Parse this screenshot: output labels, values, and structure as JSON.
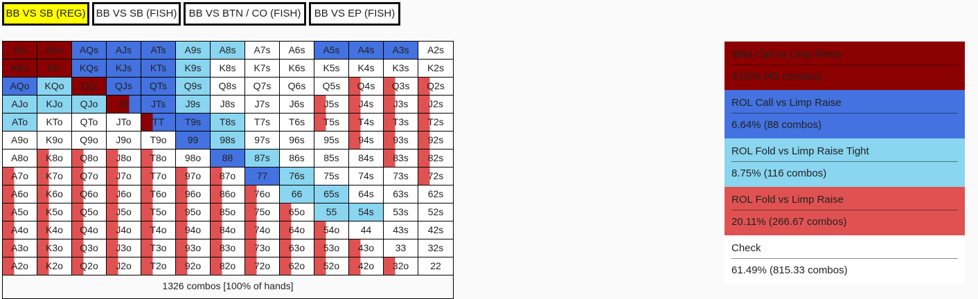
{
  "tabs": [
    {
      "label": "BB VS SB (REG)",
      "active": true
    },
    {
      "label": "BB VS SB (FISH)"
    },
    {
      "label": "BB VS BTN / CO (FISH)"
    },
    {
      "label": "BB VS EP (FISH)"
    }
  ],
  "colors": {
    "tab_active": "#ffff00",
    "check": "#ffffff"
  },
  "actions": [
    {
      "name": "4Bet Call vs Limp Raise",
      "stat": "3.02%  (40 combos)",
      "color": "#8b0000"
    },
    {
      "name": "ROL Call vs Limp Raise",
      "stat": "6.64%  (88 combos)",
      "color": "#4472e0"
    },
    {
      "name": "ROL Fold vs Limp Raise Tight",
      "stat": "8.75%  (116 combos)",
      "color": "#8ad5f0"
    },
    {
      "name": "ROL Fold vs Limp Raise",
      "stat": "20.11%  (266.67 combos)",
      "color": "#e05252"
    },
    {
      "name": "Check",
      "stat": "61.49%  (815.33 combos)",
      "color": "#ffffff"
    }
  ],
  "grid": [
    [
      "AA",
      "AKs",
      "AQs",
      "AJs",
      "ATs",
      "A9s",
      "A8s",
      "A7s",
      "A6s",
      "A5s",
      "A4s",
      "A3s",
      "A2s"
    ],
    [
      "AKo",
      "KK",
      "KQs",
      "KJs",
      "KTs",
      "K9s",
      "K8s",
      "K7s",
      "K6s",
      "K5s",
      "K4s",
      "K3s",
      "K2s"
    ],
    [
      "AQo",
      "KQo",
      "QQ",
      "QJs",
      "QTs",
      "Q9s",
      "Q8s",
      "Q7s",
      "Q6s",
      "Q5s",
      "Q4s",
      "Q3s",
      "Q2s"
    ],
    [
      "AJo",
      "KJo",
      "QJo",
      "JJ",
      "JTs",
      "J9s",
      "J8s",
      "J7s",
      "J6s",
      "J5s",
      "J4s",
      "J3s",
      "J2s"
    ],
    [
      "ATo",
      "KTo",
      "QTo",
      "JTo",
      "TT",
      "T9s",
      "T8s",
      "T7s",
      "T6s",
      "T5s",
      "T4s",
      "T3s",
      "T2s"
    ],
    [
      "A9o",
      "K9o",
      "Q9o",
      "J9o",
      "T9o",
      "99",
      "98s",
      "97s",
      "96s",
      "95s",
      "94s",
      "93s",
      "92s"
    ],
    [
      "A8o",
      "K8o",
      "Q8o",
      "J8o",
      "T8o",
      "98o",
      "88",
      "87s",
      "86s",
      "85s",
      "84s",
      "83s",
      "82s"
    ],
    [
      "A7o",
      "K7o",
      "Q7o",
      "J7o",
      "T7o",
      "97o",
      "87o",
      "77",
      "76s",
      "75s",
      "74s",
      "73s",
      "72s"
    ],
    [
      "A6o",
      "K6o",
      "Q6o",
      "J6o",
      "T6o",
      "96o",
      "86o",
      "76o",
      "66",
      "65s",
      "64s",
      "63s",
      "62s"
    ],
    [
      "A5o",
      "K5o",
      "Q5o",
      "J5o",
      "T5o",
      "95o",
      "85o",
      "75o",
      "65o",
      "55",
      "54s",
      "53s",
      "52s"
    ],
    [
      "A4o",
      "K4o",
      "Q4o",
      "J4o",
      "T4o",
      "94o",
      "84o",
      "74o",
      "64o",
      "54o",
      "44",
      "43s",
      "42s"
    ],
    [
      "A3o",
      "K3o",
      "Q3o",
      "J3o",
      "T3o",
      "93o",
      "83o",
      "73o",
      "63o",
      "53o",
      "43o",
      "33",
      "32s"
    ],
    [
      "A2o",
      "K2o",
      "Q2o",
      "J2o",
      "T2o",
      "92o",
      "82o",
      "72o",
      "62o",
      "52o",
      "42o",
      "32o",
      "22"
    ]
  ],
  "range": {
    "full": {
      "0": [
        "AA",
        "AKs",
        "AKo",
        "KK",
        "QQ"
      ],
      "1": [
        "AQs",
        "AJs",
        "ATs",
        "A5s",
        "A4s",
        "A3s",
        "KQs",
        "KJs",
        "KTs",
        "QJs",
        "QTs",
        "JTs",
        "T9s",
        "99",
        "88",
        "77",
        "AQo"
      ],
      "2": [
        "A9s",
        "A8s",
        "K9s",
        "Q9s",
        "J9s",
        "T8s",
        "98s",
        "87s",
        "76s",
        "65s",
        "54s",
        "66",
        "55",
        "KQo",
        "AJo",
        "KJo",
        "QJo",
        "ATo"
      ]
    },
    "mixed": {
      "JJ": [
        [
          0,
          0.667
        ],
        [
          1,
          0.333
        ]
      ],
      "TT": [
        [
          0,
          0.333
        ],
        [
          1,
          0.667
        ]
      ]
    },
    "third_of_action_3": [
      "K8o",
      "Q8o",
      "J8o",
      "T8o",
      "A7o",
      "K7o",
      "Q7o",
      "J7o",
      "T7o",
      "97o",
      "87o",
      "A6o",
      "K6o",
      "Q6o",
      "J6o",
      "T6o",
      "96o",
      "86o",
      "76o",
      "A5o",
      "K5o",
      "Q5o",
      "J5o",
      "T5o",
      "95o",
      "85o",
      "75o",
      "65o",
      "A4o",
      "K4o",
      "Q4o",
      "J4o",
      "T4o",
      "94o",
      "84o",
      "74o",
      "64o",
      "54o",
      "A3o",
      "K3o",
      "Q3o",
      "J3o",
      "T3o",
      "93o",
      "83o",
      "73o",
      "63o",
      "53o",
      "43o",
      "A2o",
      "K2o",
      "Q2o",
      "J2o",
      "T2o",
      "92o",
      "82o",
      "72o",
      "62o",
      "52o",
      "42o",
      "32o",
      "Q4s",
      "Q3s",
      "Q2s",
      "J5s",
      "J4s",
      "J3s",
      "J2s",
      "T5s",
      "T4s",
      "T3s",
      "T2s",
      "94s",
      "93s",
      "92s",
      "83s",
      "82s",
      "72s"
    ]
  },
  "footer": "1326 combos [100% of hands]"
}
